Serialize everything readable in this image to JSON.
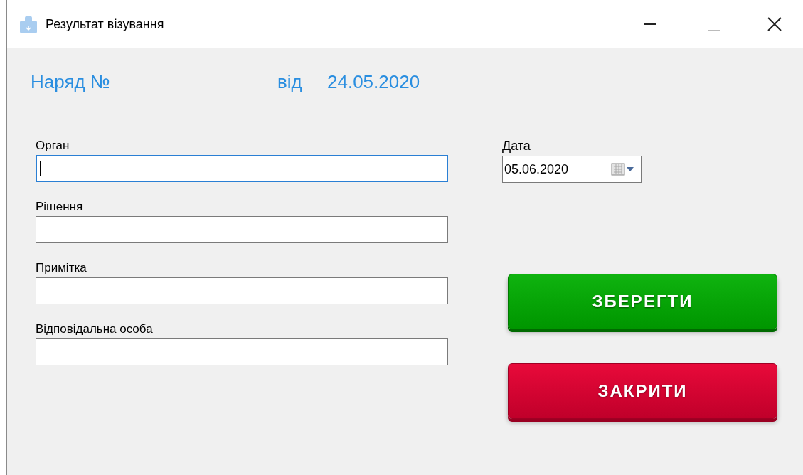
{
  "window": {
    "title": "Результат візування"
  },
  "header": {
    "order_label": "Наряд №",
    "from_label": "від",
    "date": "24.05.2020"
  },
  "fields": [
    {
      "label": "Орган",
      "focused": true
    },
    {
      "label": "Рішення",
      "focused": false
    },
    {
      "label": "Примітка",
      "focused": false
    },
    {
      "label": "Відповідальна особа",
      "focused": false
    }
  ],
  "date_field": {
    "label": "Дата",
    "value": "05.06.2020"
  },
  "buttons": [
    {
      "label": "ЗБЕРЕГТИ",
      "kind": "save"
    },
    {
      "label": "ЗАКРИТИ",
      "kind": "close"
    }
  ]
}
